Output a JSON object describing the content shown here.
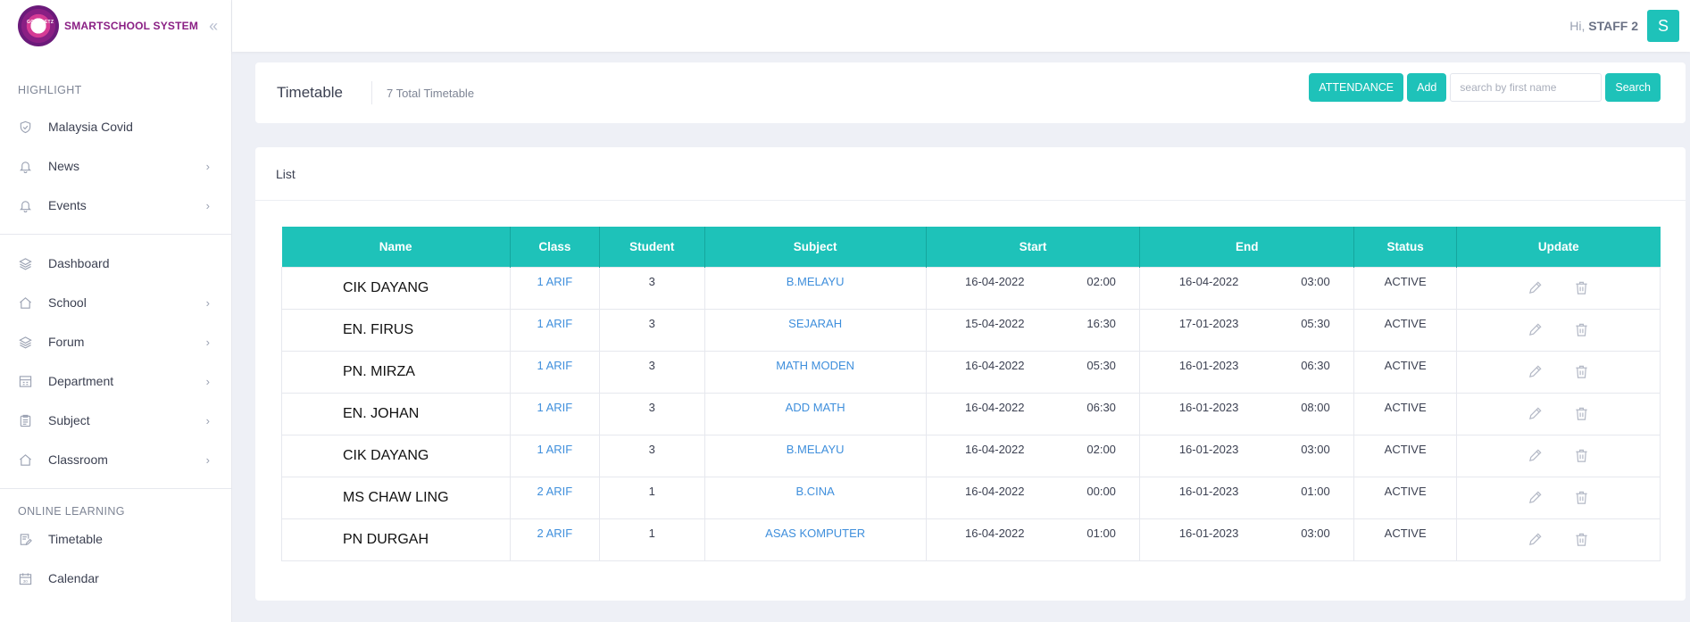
{
  "brand": {
    "name": "SMARTSCHOOL SYSTEM",
    "logo_text": "GO & GETZ"
  },
  "sidebar": {
    "section1": "HIGHLIGHT",
    "items1": [
      {
        "label": "Malaysia Covid",
        "icon": "shield-icon"
      },
      {
        "label": "News",
        "icon": "bell-icon"
      },
      {
        "label": "Events",
        "icon": "bell-icon"
      }
    ],
    "items2": [
      {
        "label": "Dashboard",
        "icon": "layers-icon"
      },
      {
        "label": "School",
        "icon": "home-icon"
      },
      {
        "label": "Forum",
        "icon": "layers-icon"
      },
      {
        "label": "Department",
        "icon": "building-icon"
      },
      {
        "label": "Subject",
        "icon": "clipboard-icon"
      },
      {
        "label": "Classroom",
        "icon": "home-icon"
      }
    ],
    "section2": "ONLINE LEARNING",
    "items3": [
      {
        "label": "Timetable",
        "icon": "edit-doc-icon"
      },
      {
        "label": "Calendar",
        "icon": "calendar-icon"
      }
    ]
  },
  "topbar": {
    "greeting": "Hi,",
    "user": "STAFF 2",
    "avatar": "S"
  },
  "header": {
    "title": "Timetable",
    "total": "7 Total Timetable",
    "attendance_label": "ATTENDANCE",
    "add_label": "Add",
    "search_placeholder": "search by first name",
    "search_label": "Search"
  },
  "list": {
    "title": "List",
    "columns": [
      "Name",
      "Class",
      "Student",
      "Subject",
      "Start",
      "End",
      "Status",
      "Update"
    ],
    "rows": [
      {
        "name": "CIK DAYANG",
        "class": "1 ARIF",
        "student": "3",
        "subject": "B.MELAYU",
        "start_date": "16-04-2022",
        "start_time": "02:00",
        "end_date": "16-04-2022",
        "end_time": "03:00",
        "status": "ACTIVE"
      },
      {
        "name": "EN. FIRUS",
        "class": "1 ARIF",
        "student": "3",
        "subject": "SEJARAH",
        "start_date": "15-04-2022",
        "start_time": "16:30",
        "end_date": "17-01-2023",
        "end_time": "05:30",
        "status": "ACTIVE"
      },
      {
        "name": "PN. MIRZA",
        "class": "1 ARIF",
        "student": "3",
        "subject": "MATH MODEN",
        "start_date": "16-04-2022",
        "start_time": "05:30",
        "end_date": "16-01-2023",
        "end_time": "06:30",
        "status": "ACTIVE"
      },
      {
        "name": "EN. JOHAN",
        "class": "1 ARIF",
        "student": "3",
        "subject": "ADD MATH",
        "start_date": "16-04-2022",
        "start_time": "06:30",
        "end_date": "16-01-2023",
        "end_time": "08:00",
        "status": "ACTIVE"
      },
      {
        "name": "CIK DAYANG",
        "class": "1 ARIF",
        "student": "3",
        "subject": "B.MELAYU",
        "start_date": "16-04-2022",
        "start_time": "02:00",
        "end_date": "16-01-2023",
        "end_time": "03:00",
        "status": "ACTIVE"
      },
      {
        "name": "MS CHAW LING",
        "class": "2 ARIF",
        "student": "1",
        "subject": "B.CINA",
        "start_date": "16-04-2022",
        "start_time": "00:00",
        "end_date": "16-01-2023",
        "end_time": "01:00",
        "status": "ACTIVE"
      },
      {
        "name": "PN DURGAH",
        "class": "2 ARIF",
        "student": "1",
        "subject": "ASAS KOMPUTER",
        "start_date": "16-04-2022",
        "start_time": "01:00",
        "end_date": "16-01-2023",
        "end_time": "03:00",
        "status": "ACTIVE"
      }
    ]
  },
  "colors": {
    "accent": "#1ec2b9",
    "link": "#3f8fdc",
    "brand": "#8a1f84"
  }
}
